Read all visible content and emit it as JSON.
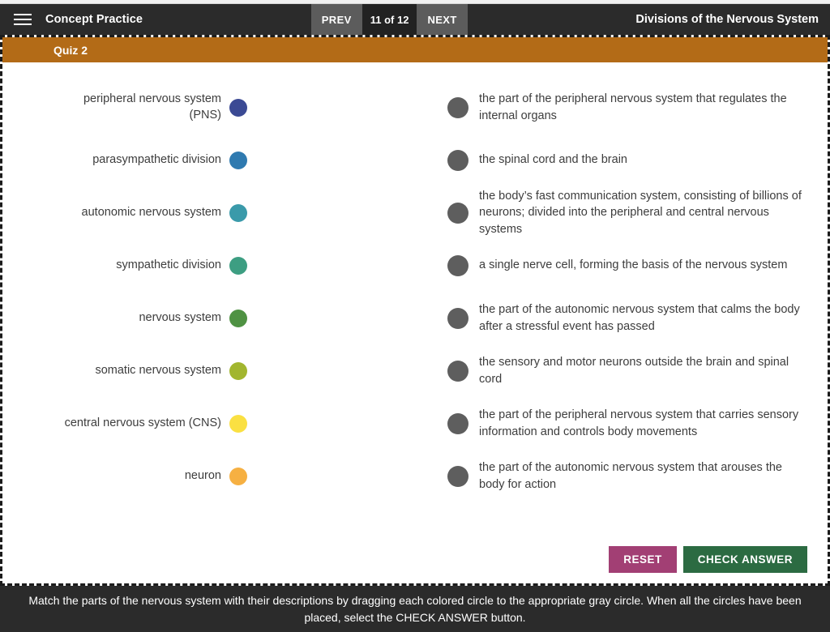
{
  "header": {
    "menu_icon": "hamburger-menu-icon",
    "app_title": "Concept Practice",
    "prev_label": "PREV",
    "page_counter": "11 of 12",
    "next_label": "NEXT",
    "lesson_title": "Divisions of the Nervous System"
  },
  "quiz": {
    "banner_label": "Quiz 2",
    "banner_color": "#b36b17"
  },
  "terms": [
    {
      "label": "peripheral nervous system (PNS)",
      "color": "#3b4a94"
    },
    {
      "label": "parasympathetic division",
      "color": "#2f7ab0"
    },
    {
      "label": "autonomic nervous system",
      "color": "#3a9aaa"
    },
    {
      "label": "sympathetic division",
      "color": "#3d9e82"
    },
    {
      "label": "nervous system",
      "color": "#4f9243"
    },
    {
      "label": "somatic nervous system",
      "color": "#a2b62f"
    },
    {
      "label": "central nervous system (CNS)",
      "color": "#fae042"
    },
    {
      "label": "neuron",
      "color": "#f6b042"
    }
  ],
  "definitions": [
    {
      "text": "the part of the peripheral nervous system that regulates the internal organs"
    },
    {
      "text": "the spinal cord and the brain"
    },
    {
      "text": "the body’s fast communication system, consisting of billions of neurons; divided into the peripheral and central nervous systems"
    },
    {
      "text": "a single nerve cell, forming the basis of the nervous system"
    },
    {
      "text": "the part of the autonomic nervous system that calms the body after a stressful event has passed"
    },
    {
      "text": "the sensory and motor neurons outside the brain and spinal cord"
    },
    {
      "text": "the part of the peripheral nervous system that carries sensory information and controls body movements"
    },
    {
      "text": "the part of the autonomic nervous system that arouses the body for action"
    }
  ],
  "target_color": "#5e5e5e",
  "actions": {
    "reset_label": "RESET",
    "reset_color": "#a23f74",
    "check_label": "CHECK ANSWER",
    "check_color": "#2c6b42"
  },
  "instructions": {
    "text": "Match the parts of the nervous system with their descriptions by dragging each colored circle to the appropriate gray circle. When all the circles have been placed, select the CHECK ANSWER button."
  }
}
